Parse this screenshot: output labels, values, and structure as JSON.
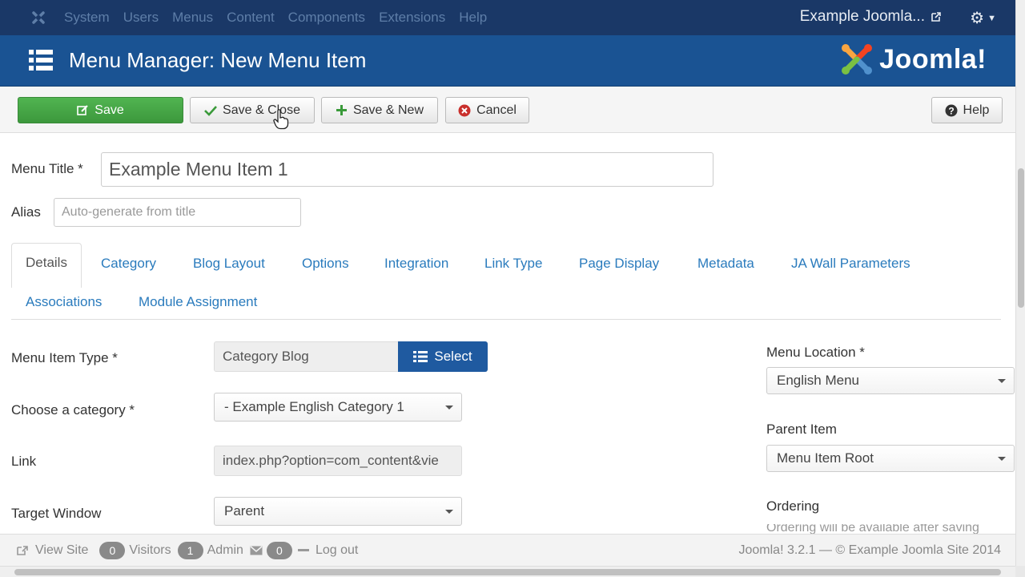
{
  "topnav": {
    "menu": [
      "System",
      "Users",
      "Menus",
      "Content",
      "Components",
      "Extensions",
      "Help"
    ],
    "site_link": "Example Joomla..."
  },
  "header": {
    "title": "Menu Manager: New Menu Item",
    "brand": "Joomla!"
  },
  "toolbar": {
    "save": "Save",
    "save_close": "Save & Close",
    "save_new": "Save & New",
    "cancel": "Cancel",
    "help": "Help"
  },
  "form": {
    "menu_title_label": "Menu Title *",
    "menu_title_value": "Example Menu Item 1",
    "alias_label": "Alias",
    "alias_placeholder": "Auto-generate from title"
  },
  "tabs": {
    "row1": [
      "Details",
      "Category",
      "Blog Layout",
      "Options",
      "Integration",
      "Link Type",
      "Page Display",
      "Metadata",
      "JA Wall Parameters"
    ],
    "row2": [
      "Associations",
      "Module Assignment"
    ],
    "active": "Details"
  },
  "details": {
    "menu_item_type_label": "Menu Item Type *",
    "menu_item_type_value": "Category Blog",
    "select_button": "Select",
    "category_label": "Choose a category *",
    "category_value": "- Example English Category 1",
    "link_label": "Link",
    "link_value": "index.php?option=com_content&vie",
    "target_label": "Target Window",
    "target_value": "Parent"
  },
  "sidebar": {
    "menu_location_label": "Menu Location *",
    "menu_location_value": "English Menu",
    "parent_item_label": "Parent Item",
    "parent_item_value": "Menu Item Root",
    "ordering_label": "Ordering",
    "ordering_note": "Ordering will be available after saving"
  },
  "footer": {
    "view_site": "View Site",
    "visitors_count": "0",
    "visitors": "Visitors",
    "admin_count": "1",
    "admin": "Admin",
    "messages_count": "0",
    "logout": "Log out",
    "version": "Joomla! 3.2.1 — © Example Joomla Site 2014"
  },
  "colors": {
    "topnav": "#1a3867",
    "header": "#1a5393",
    "save_green": "#46a546",
    "select_blue": "#1f5aa0",
    "tab_link": "#2a7bbd"
  }
}
